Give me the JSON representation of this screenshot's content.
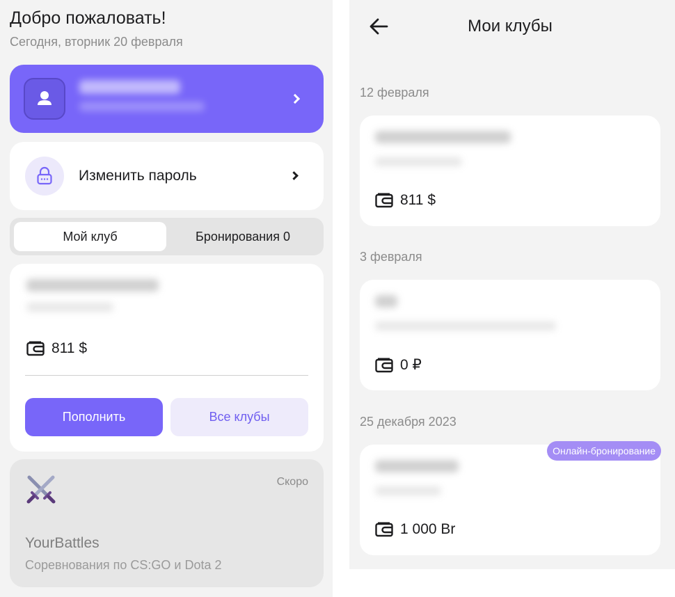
{
  "left": {
    "welcome": "Добро пожаловать!",
    "today": "Сегодня, вторник 20 февраля",
    "profile": {
      "name": "",
      "subtitle": ""
    },
    "change_password": "Изменить пароль",
    "tabs": {
      "my_club": "Мой клуб",
      "bookings": "Бронирования 0"
    },
    "club": {
      "balance": "811 $"
    },
    "buttons": {
      "top_up": "Пополнить",
      "all_clubs": "Все клубы"
    },
    "battles": {
      "soon": "Скоро",
      "title": "YourBattles",
      "subtitle": "Соревнования по CS:GO и Dota 2"
    }
  },
  "right": {
    "title": "Мои клубы",
    "entries": [
      {
        "date": "12 февраля",
        "balance": "811 $",
        "badge": ""
      },
      {
        "date": "3 февраля",
        "balance": "0 ₽",
        "badge": ""
      },
      {
        "date": "25 декабря 2023",
        "balance": "1 000 Br",
        "badge": "Онлайн-бронирование"
      }
    ]
  },
  "colors": {
    "accent": "#7866f9",
    "accent_soft": "#eeebfb",
    "badge": "#a48df5",
    "background": "#f3f3f3"
  },
  "icons": [
    "user-icon",
    "chevron-right-icon",
    "lock-icon",
    "wallet-icon",
    "swords-icon",
    "arrow-left-icon"
  ]
}
